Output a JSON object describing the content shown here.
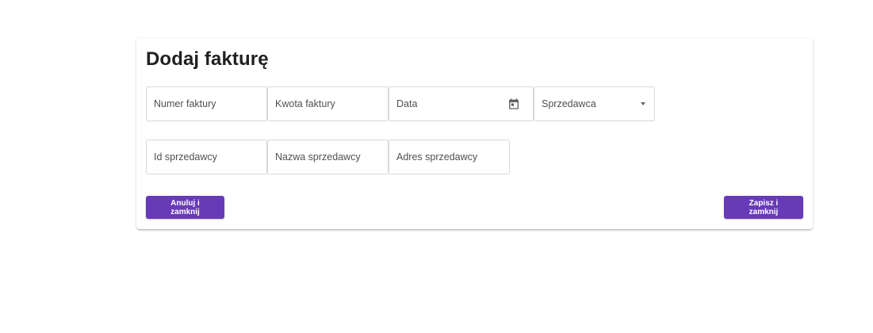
{
  "card": {
    "title": "Dodaj fakturę"
  },
  "form": {
    "invoice_number_label": "Numer faktury",
    "invoice_amount_label": "Kwota faktury",
    "date_label": "Data",
    "seller_select_label": "Sprzedawca",
    "seller_id_label": "Id sprzedawcy",
    "seller_name_label": "Nazwa sprzedawcy",
    "seller_address_label": "Adres sprzedawcy"
  },
  "actions": {
    "cancel_label": "Anuluj i zamknij",
    "save_label": "Zapisz i zamknij"
  },
  "theme": {
    "accent": "#673ab7",
    "icon_names": [
      "calendar-icon",
      "dropdown-arrow-icon"
    ]
  }
}
